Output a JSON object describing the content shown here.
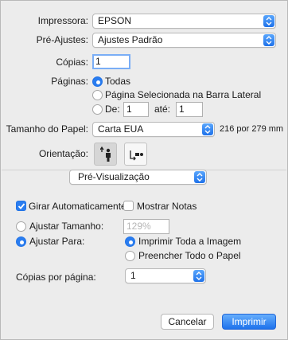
{
  "printer": {
    "label": "Impressora:",
    "value": "EPSON"
  },
  "presets": {
    "label": "Pré-Ajustes:",
    "value": "Ajustes Padrão"
  },
  "copies": {
    "label": "Cópias:",
    "value": "1"
  },
  "pages": {
    "label": "Páginas:",
    "all": "Todas",
    "selection": "Página Selecionada na Barra Lateral",
    "from_label": "De:",
    "from_value": "1",
    "to_label": "até:",
    "to_value": "1",
    "selected": "all"
  },
  "paper_size": {
    "label": "Tamanho do Papel:",
    "value": "Carta EUA",
    "dimensions": "216 por 279 mm"
  },
  "orientation": {
    "label": "Orientação:",
    "selected": "portrait"
  },
  "section_popup": {
    "value": "Pré-Visualização"
  },
  "auto_rotate": {
    "label": "Girar Automaticamente",
    "checked": true
  },
  "show_notes": {
    "label": "Mostrar Notas",
    "checked": false
  },
  "scale": {
    "label": "Ajustar Tamanho:",
    "placeholder": "129%"
  },
  "scale_to_fit": {
    "label": "Ajustar Para:",
    "print_entire": "Imprimir Toda a Imagem",
    "fill_paper": "Preencher Todo o Papel"
  },
  "copies_per_page": {
    "label": "Cópias por página:",
    "value": "1"
  },
  "buttons": {
    "cancel": "Cancelar",
    "print": "Imprimir"
  },
  "colors": {
    "accent": "#2a7df0",
    "background": "#ececec"
  }
}
